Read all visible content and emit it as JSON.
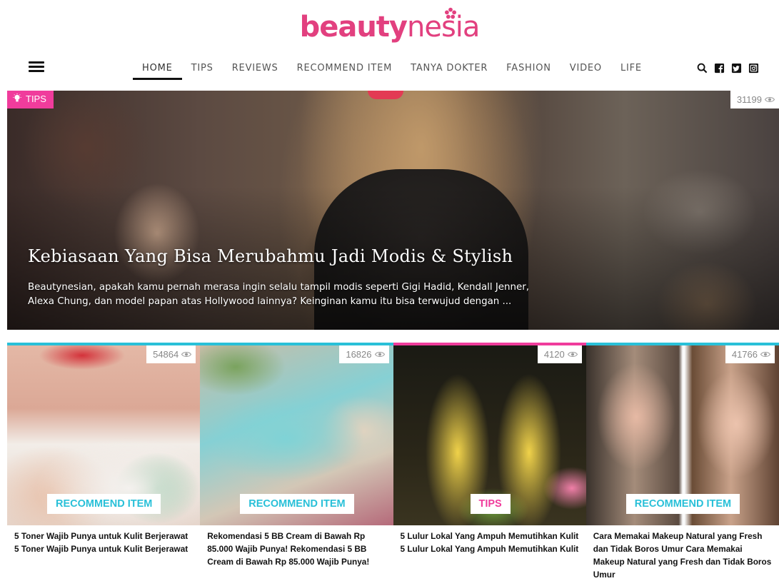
{
  "logo": {
    "part1": "beauty",
    "part2": "nesia"
  },
  "nav": {
    "items": [
      "HOME",
      "TIPS",
      "REVIEWS",
      "RECOMMEND ITEM",
      "TANYA DOKTER",
      "FASHION",
      "VIDEO",
      "LIFE"
    ],
    "active": "HOME",
    "icons": [
      "search-icon",
      "facebook-icon",
      "twitter-icon",
      "instagram-icon"
    ]
  },
  "hero": {
    "category": "TIPS",
    "views": "31199",
    "title": "Kebiasaan Yang Bisa Merubahmu Jadi Modis & Stylish",
    "excerpt": "Beautynesian, apakah kamu pernah merasa ingin selalu tampil modis seperti Gigi Hadid, Kendall Jenner, Alexa Chung, dan model papan atas Hollywood lainnya? Keinginan kamu itu bisa terwujud dengan ..."
  },
  "cards": [
    {
      "views": "54864",
      "category": "RECOMMEND ITEM",
      "title": "5 Toner Wajib Punya untuk Kulit Berjerawat 5 Toner Wajib Punya untuk Kulit Berjerawat",
      "accent": "#29c0d8"
    },
    {
      "views": "16826",
      "category": "RECOMMEND ITEM",
      "title": "Rekomendasi 5 BB Cream di Bawah Rp 85.000 Wajib Punya! Rekomendasi 5 BB Cream di Bawah Rp 85.000 Wajib Punya!",
      "accent": "#29c0d8"
    },
    {
      "views": "4120",
      "category": "TIPS",
      "title": "5 Lulur Lokal Yang Ampuh Memutihkan Kulit 5 Lulur Lokal Yang Ampuh Memutihkan Kulit",
      "accent": "#f03c9c"
    },
    {
      "views": "41766",
      "category": "RECOMMEND ITEM",
      "title": "Cara Memakai Makeup Natural yang Fresh dan Tidak Boros Umur Cara Memakai Makeup Natural yang Fresh dan Tidak Boros Umur",
      "accent": "#29c0d8"
    }
  ],
  "colors": {
    "brand": "#e2407f",
    "tips": "#f03c9c",
    "recommend": "#29c0d8"
  }
}
